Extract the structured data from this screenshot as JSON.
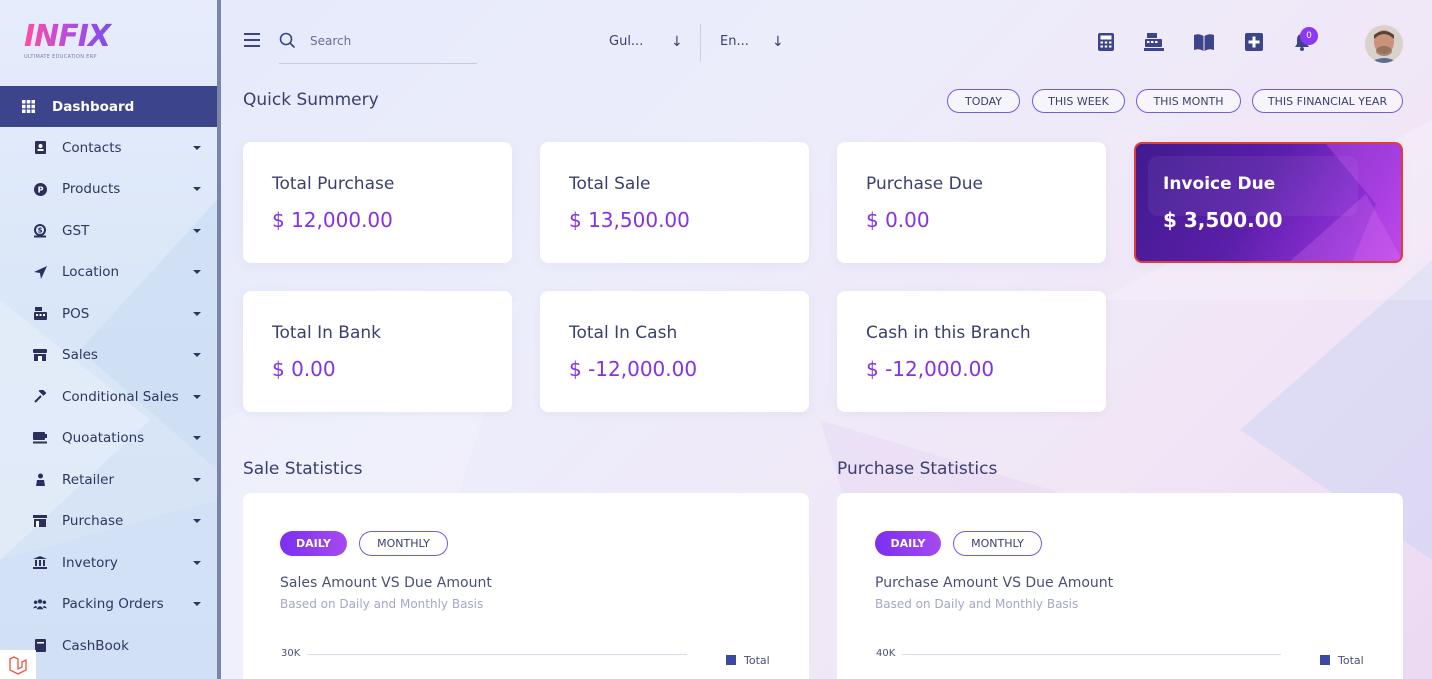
{
  "app": {
    "logo_text": "INFIX",
    "logo_subtitle": "ULTIMATE EDUCATION ERP"
  },
  "sidebar": {
    "items": [
      {
        "label": "Dashboard",
        "icon": "grid-icon",
        "active": true
      },
      {
        "label": "Contacts",
        "icon": "contacts-icon"
      },
      {
        "label": "Products",
        "icon": "products-icon"
      },
      {
        "label": "GST",
        "icon": "gst-icon"
      },
      {
        "label": "Location",
        "icon": "location-icon"
      },
      {
        "label": "POS",
        "icon": "pos-icon"
      },
      {
        "label": "Sales",
        "icon": "sales-icon"
      },
      {
        "label": "Conditional Sales",
        "icon": "gavel-icon"
      },
      {
        "label": "Quoatations",
        "icon": "quotation-icon"
      },
      {
        "label": "Retailer",
        "icon": "retailer-icon"
      },
      {
        "label": "Purchase",
        "icon": "purchase-icon"
      },
      {
        "label": "Invetory",
        "icon": "inventory-icon"
      },
      {
        "label": "Packing Orders",
        "icon": "users-icon"
      },
      {
        "label": "CashBook",
        "icon": "cashbook-icon"
      }
    ]
  },
  "header": {
    "search_placeholder": "Search",
    "branch_select": "Gul...",
    "language_select": "En...",
    "notification_count": "0",
    "icons": [
      "calculator-icon",
      "cash-register-icon",
      "book-icon",
      "plus-square-icon",
      "bell-icon"
    ]
  },
  "summary": {
    "title": "Quick Summery",
    "filters": [
      "TODAY",
      "THIS WEEK",
      "THIS MONTH",
      "THIS FINANCIAL YEAR"
    ],
    "cards": [
      {
        "title": "Total Purchase",
        "value": "$ 12,000.00"
      },
      {
        "title": "Total Sale",
        "value": "$ 13,500.00"
      },
      {
        "title": "Purchase Due",
        "value": "$ 0.00"
      },
      {
        "title": "Invoice Due",
        "value": "$ 3,500.00"
      },
      {
        "title": "Total In Bank",
        "value": "$ 0.00"
      },
      {
        "title": "Total In Cash",
        "value": "$ -12,000.00"
      },
      {
        "title": "Cash in this Branch",
        "value": "$ -12,000.00"
      }
    ]
  },
  "sale_stats": {
    "title": "Sale Statistics",
    "tab_daily": "DAILY",
    "tab_monthly": "MONTHLY",
    "chart_title": "Sales Amount VS Due Amount",
    "chart_subtitle": "Based on Daily and Monthly Basis",
    "y_tick": "30K",
    "legend": "Total"
  },
  "purchase_stats": {
    "title": "Purchase Statistics",
    "tab_daily": "DAILY",
    "tab_monthly": "MONTHLY",
    "chart_title": "Purchase Amount VS Due Amount",
    "chart_subtitle": "Based on Daily and Monthly Basis",
    "y_tick": "40K",
    "legend": "Total"
  },
  "colors": {
    "accent": "#8432e6",
    "sidebar_active": "#3c448c",
    "highlight_border": "#e23b3b"
  }
}
